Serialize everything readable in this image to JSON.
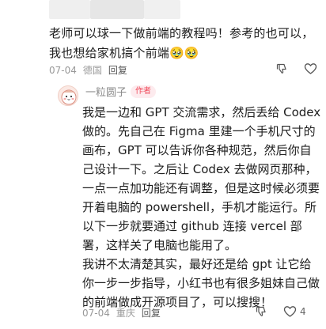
{
  "comment_top": {
    "text": "老师可以球一下做前端的教程吗！参考的也可以，我也想给家机搞个前端🥹🥹",
    "date": "07-04",
    "location": "德国",
    "reply_label": "回复",
    "likes": "",
    "dislike_icon": "thumb-down-icon",
    "like_icon": "heart-icon"
  },
  "comment_author": {
    "username": "一粒圆子",
    "badge": "作者",
    "paragraph1": "我是一边和 GPT 交流需求，然后丢给 Codex 做的。先自己在 Figma 里建一个手机尺寸的画布，GPT 可以告诉你各种规范，然后你自己设计一下。之后让 Codex 去做网页那种，一点一点加功能还有调整，但是这时候必须要开着电脑的 powershell，手机才能运行。所以下一步就要通过 github 连接 vercel 部署，这样关了电脑也能用了。",
    "paragraph2": "我讲不太清楚其实，最好还是给 gpt 让它给你一步一步指导，小红书也有很多姐妹自己做的前端做成开源项目了，可以搜搜！",
    "date": "07-04",
    "location": "重庆",
    "reply_label": "回复",
    "likes": "4",
    "dislike_icon": "thumb-down-icon",
    "like_icon": "heart-icon"
  }
}
